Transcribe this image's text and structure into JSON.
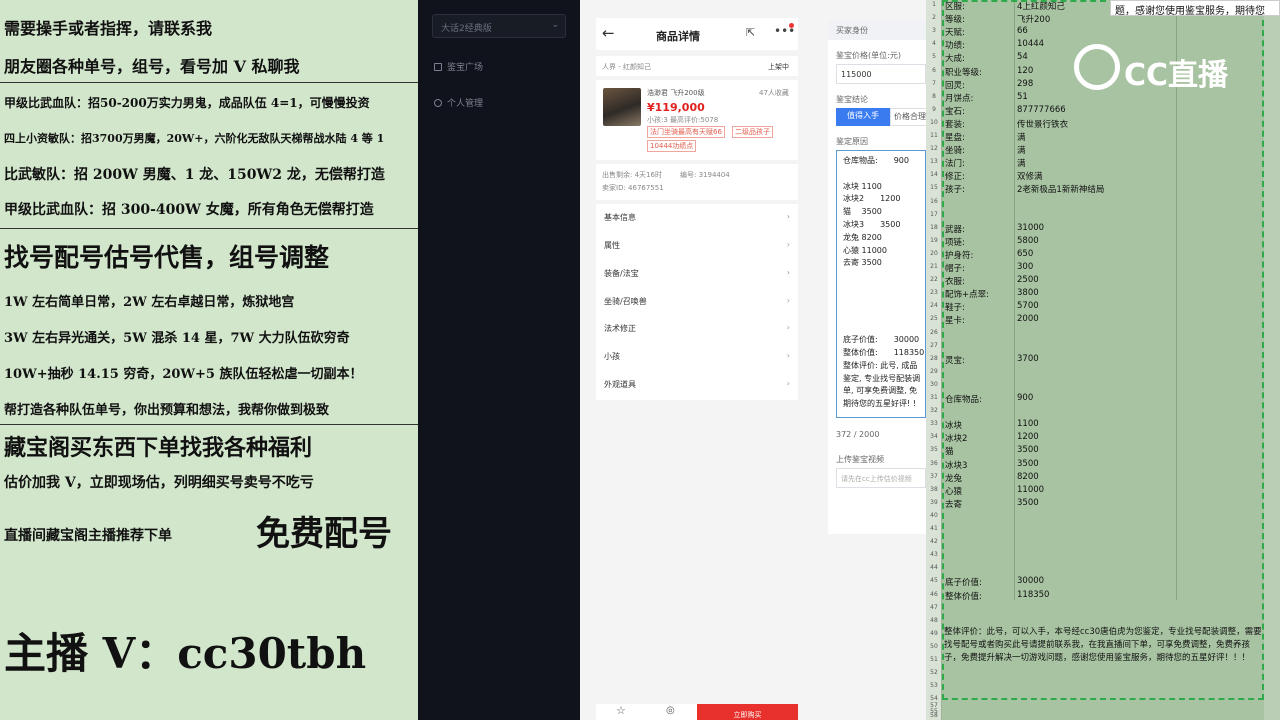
{
  "promo": {
    "l1": "需要操手或者指挥，请联系我",
    "l2": "朋友圈各种单号，组号，看号加 V 私聊我",
    "l3": "甲级比武血队：招50-200万实力男鬼，成品队伍 4=1，可慢慢投资",
    "l4": "四上小资敏队：招3700万男魔，20W+，六阶化无敌队天梯帮战水陆 4 等 1",
    "l5": "比武敏队：招 200W 男魔、1 龙、150W2 龙，无偿帮打造",
    "l6": "甲级比武血队：招 300-400W 女魔，所有角色无偿帮打造",
    "l7": "找号配号估号代售，组号调整",
    "l8": "1W 左右简单日常，2W 左右卓越日常，炼狱地宫",
    "l9": "3W 左右异光通关，5W 混杀 14 星，7W 大力队伍砍穷奇",
    "l10": "10W+抽秒 14.15 穷奇，20W+5 族队伍轻松虐一切副本！",
    "l11": "帮打造各种队伍单号，你出预算和想法，我帮你做到极致",
    "l12": "藏宝阁买东西下单找我各种福利",
    "l13": "估价加我 V，立即现场估，列明细买号卖号不吃亏",
    "l14a": "直播间藏宝阁主播推荐下单",
    "l14b": "免费配号",
    "l15": "主播 V：cc30tbh"
  },
  "admin": {
    "select": "大话2经典版",
    "nav1": "鉴宝广场",
    "nav2": "个人管理"
  },
  "phone": {
    "title": "商品详情",
    "server": "人界 - 红颜知己",
    "status": "上架中",
    "seller": "浩渺君 飞升200级",
    "favs": "47人收藏",
    "price": "¥119,000",
    "meta": "小孩:3 最高评价:5078",
    "tag1": "法门坐骑最高有天赋66",
    "tag2": "二级品孩子",
    "tag3": "10444功绩点",
    "time": "出售剩余: 4天16时",
    "no": "编号: 3194404",
    "id": "卖家ID: 46767551",
    "menu": [
      "基本信息",
      "属性",
      "装备/法宝",
      "坐骑/召唤兽",
      "法术修正",
      "小孩",
      "外观道具"
    ],
    "buy": "立即购买"
  },
  "form": {
    "section": "买家身份",
    "price_label": "鉴宝价格(单位:元)",
    "price_value": "115000",
    "result_label": "鉴宝结论",
    "btn_primary": "值得入手",
    "btn_second": "价格合理",
    "reason_label": "鉴定原因",
    "text": [
      "仓库物品:　　900",
      "",
      "冰块 1100",
      "冰块2　　1200",
      "猫　 3500",
      "冰块3　　3500",
      "龙兔 8200",
      "心猿 11000",
      "去寄 3500",
      "",
      "",
      "",
      "",
      "",
      "底子价值:　　30000",
      "整体价值:　　118350",
      "整体评价: 此号, 成品",
      "鉴定, 专业找号配装调",
      "单, 可享免费调整, 免",
      "期待您的五星好评! !"
    ],
    "counter": "372 / 2000",
    "video_label": "上传鉴宝视频",
    "video_placeholder": "请先在cc上传估价视频"
  },
  "sheet": {
    "banner": "题，感谢您使用鉴宝服务，期待您",
    "logo": "CC直播",
    "rows": [
      [
        "区服:",
        "4上红颜知己"
      ],
      [
        "等级:",
        "飞升200"
      ],
      [
        "天赋:",
        "66"
      ],
      [
        "功绩:",
        "10444"
      ],
      [
        "大成:",
        "54"
      ],
      [
        "职业等级:",
        "120"
      ],
      [
        "回灵:",
        "298"
      ],
      [
        "月饼点:",
        "51"
      ],
      [
        "宝石:",
        "877777666"
      ],
      [
        "套装:",
        "传世景行铁衣"
      ],
      [
        "星盘:",
        "满"
      ],
      [
        "坐骑:",
        "满"
      ],
      [
        "法门:",
        "满"
      ],
      [
        "修正:",
        "双修满"
      ],
      [
        "孩子:",
        "2老新极品1新新神结局"
      ],
      [
        "",
        ""
      ],
      [
        "",
        ""
      ],
      [
        "武器:",
        "31000"
      ],
      [
        "项链:",
        "5800"
      ],
      [
        "护身符:",
        "650"
      ],
      [
        "帽子:",
        "300"
      ],
      [
        "衣服:",
        "2500"
      ],
      [
        "配饰+点翠:",
        "3800"
      ],
      [
        "鞋子:",
        "5700"
      ],
      [
        "星卡:",
        "2000"
      ],
      [
        "",
        ""
      ],
      [
        "",
        ""
      ],
      [
        "灵宝:",
        "3700"
      ],
      [
        "",
        ""
      ],
      [
        "",
        ""
      ],
      [
        "仓库物品:",
        "900"
      ],
      [
        "",
        ""
      ],
      [
        "冰块",
        "1100"
      ],
      [
        "冰块2",
        "1200"
      ],
      [
        "猫",
        "3500"
      ],
      [
        "冰块3",
        "3500"
      ],
      [
        "龙兔",
        "8200"
      ],
      [
        "心猿",
        "11000"
      ],
      [
        "去寄",
        "3500"
      ],
      [
        "",
        ""
      ],
      [
        "",
        ""
      ],
      [
        "",
        ""
      ],
      [
        "",
        ""
      ],
      [
        "",
        ""
      ],
      [
        "底子价值:",
        "30000"
      ],
      [
        "整体价值:",
        "118350"
      ]
    ],
    "eval": "整体评价：此号，可以入手，本号经cc30唐伯虎为您鉴定，专业找号配装调整，需要找号配号或者购买此号请提前联系我，在我直播间下单，可享免费调整，免费养孩子，免费提升解决一切游戏问题，感谢您使用鉴宝服务，期待您的五星好评！！！",
    "rownums": [
      "1",
      "2",
      "3",
      "4",
      "5",
      "6",
      "7",
      "8",
      "9",
      "10",
      "11",
      "12",
      "13",
      "14",
      "15",
      "16",
      "17",
      "18",
      "19",
      "20",
      "21",
      "22",
      "23",
      "24",
      "25",
      "26",
      "27",
      "28",
      "29",
      "30",
      "31",
      "32",
      "33",
      "34",
      "35",
      "36",
      "37",
      "38",
      "39",
      "40",
      "41",
      "42",
      "43",
      "44",
      "45",
      "46",
      "47",
      "48",
      "49",
      "50",
      "51",
      "52",
      "53",
      "54",
      "55",
      "56",
      "57",
      "58"
    ]
  }
}
